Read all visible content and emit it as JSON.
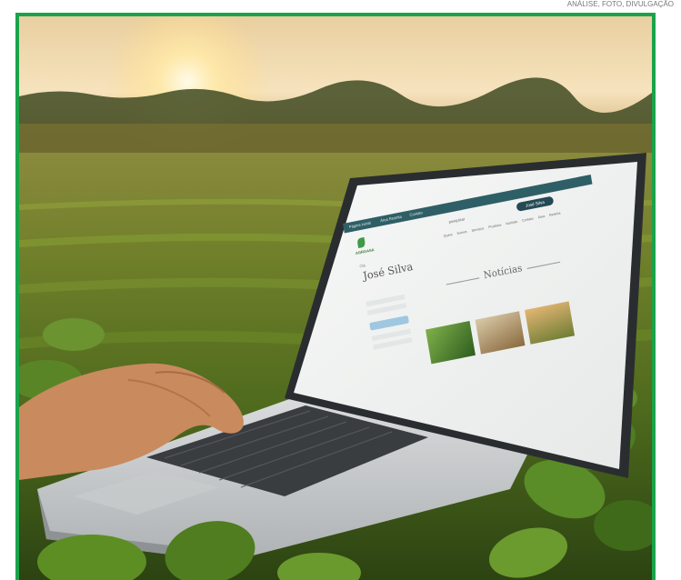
{
  "corner_caption": "ANÁLISE, FOTO, DIVULGAÇÃO",
  "scene": {
    "frame_color": "#1aa34a",
    "sky_color": "#f3d8a6",
    "field_color": "#5d7a22",
    "laptop_color": "#cfd2d4"
  },
  "screen": {
    "topbar_links": [
      "Página inicial",
      "Área Restrita",
      "Contato"
    ],
    "logo_text": "AGROASA",
    "search_placeholder": "pesquisar",
    "user_name_button": "José Silva",
    "nav_links": [
      "Quem Somos",
      "Serviços",
      "Produtos",
      "Notícias",
      "Contato",
      "Área Restrita"
    ],
    "greeting_label": "Olá",
    "greeting_name": "José Silva",
    "section_title": "Notícias"
  }
}
